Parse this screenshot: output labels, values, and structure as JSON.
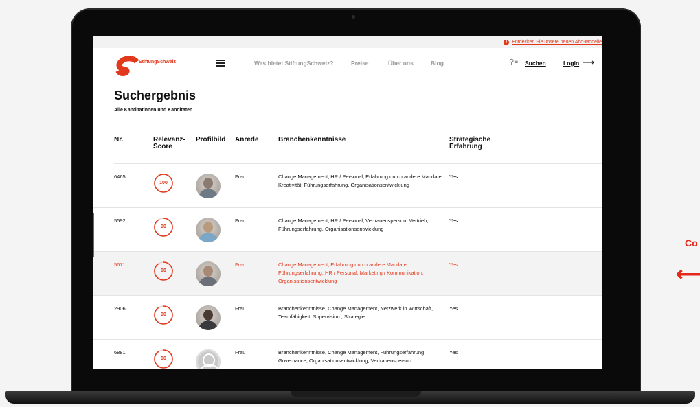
{
  "notice": {
    "text": "Entdecken Sie unsere neuen Abo-Modelle"
  },
  "brand": {
    "name": "StiftungSchweiz",
    "color": "#e2391c"
  },
  "nav": {
    "links": [
      "Was bietet StiftungSchweiz?",
      "Preise",
      "Über uns",
      "Blog"
    ],
    "search_label": "Suchen",
    "login_label": "Login",
    "login_arrow": "⟶"
  },
  "page": {
    "title": "Suchergebnis",
    "subtitle": "Alle Kanditatinnen und Kanditaten"
  },
  "table": {
    "headers": {
      "nr": "Nr.",
      "score": "Relevanz-\nScore",
      "bild": "Profilbild",
      "anrede": "Anrede",
      "branchen": "Branchenkenntnisse",
      "strat": "Strategische\nErfahrung"
    },
    "rows": [
      {
        "nr": "6465",
        "score": "100",
        "score_fraction": 1.0,
        "anrede": "Frau",
        "branchen": "Change Management, HR / Personal, Erfahrung durch andere Mandate, Kreativität, Führungserfahrung, Organisationsentwicklung",
        "strat": "Yes",
        "highlight": false,
        "avatar": "photo"
      },
      {
        "nr": "5592",
        "score": "90",
        "score_fraction": 0.9,
        "anrede": "Frau",
        "branchen": "Change Management, HR / Personal, Vertrauensperson, Vertrieb, Führungserfahrung, Organisationsentwicklung",
        "strat": "Yes",
        "highlight": false,
        "avatar": "photo"
      },
      {
        "nr": "5671",
        "score": "90",
        "score_fraction": 0.9,
        "anrede": "Frau",
        "branchen": "Change Management, Erfahrung durch andere Mandate, Führungserfahrung, HR / Personal, Marketing / Kommunikation, Organisationsentwicklung",
        "strat": "Yes",
        "highlight": true,
        "avatar": "photo"
      },
      {
        "nr": "2906",
        "score": "90",
        "score_fraction": 0.9,
        "anrede": "Frau",
        "branchen": "Branchenkenntnisse, Change Management, Netzwerk in Wirtschaft, Teamfähigkeit, Supervision , Strategie",
        "strat": "Yes",
        "highlight": false,
        "avatar": "photo"
      },
      {
        "nr": "6881",
        "score": "90",
        "score_fraction": 0.9,
        "anrede": "Frau",
        "branchen": "Branchenkenntnisse, Change Management, Führungserfahrung, Governance, Organisationsentwicklung, Vertrauensperson",
        "strat": "Yes",
        "highlight": false,
        "avatar": "placeholder-user-icon"
      }
    ]
  },
  "side_cta": {
    "text": "Co",
    "arrow": "⟵"
  }
}
